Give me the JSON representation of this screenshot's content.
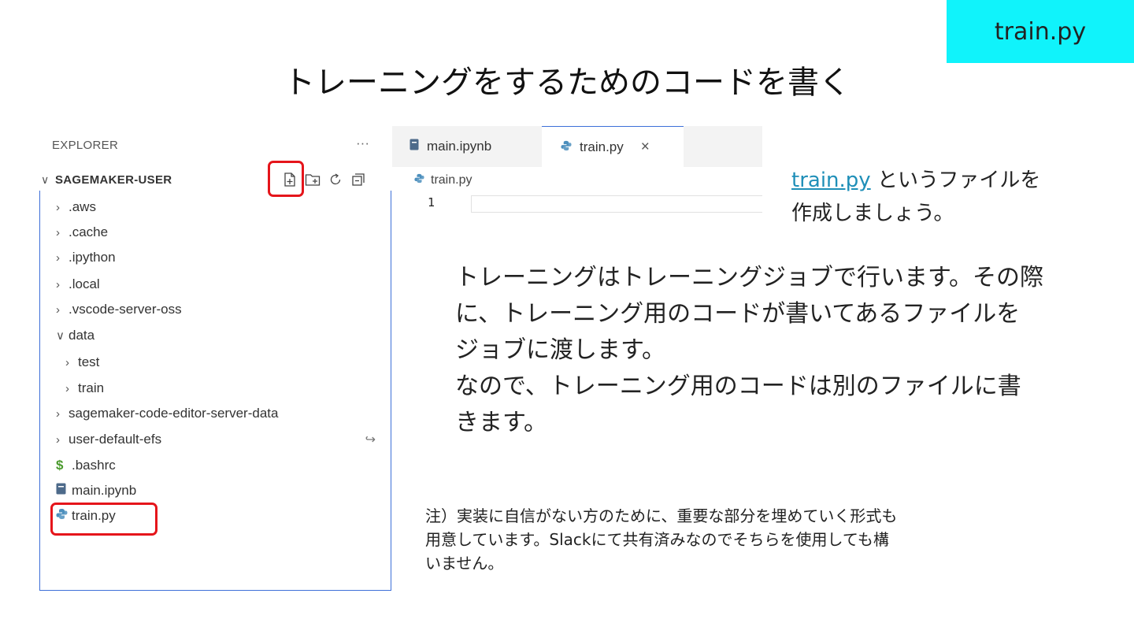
{
  "tag": "train.py",
  "title": "トレーニングをするためのコードを書く",
  "explorer": {
    "header": "EXPLORER",
    "more": "···",
    "root": "SAGEMAKER-USER",
    "items": [
      {
        "label": ".aws",
        "kind": "folder"
      },
      {
        "label": ".cache",
        "kind": "folder"
      },
      {
        "label": ".ipython",
        "kind": "folder"
      },
      {
        "label": ".local",
        "kind": "folder"
      },
      {
        "label": ".vscode-server-oss",
        "kind": "folder"
      },
      {
        "label": "data",
        "kind": "folder-open"
      },
      {
        "label": "test",
        "kind": "folder"
      },
      {
        "label": "train",
        "kind": "folder"
      },
      {
        "label": "sagemaker-code-editor-server-data",
        "kind": "folder"
      },
      {
        "label": "user-default-efs",
        "kind": "folder"
      },
      {
        "label": ".bashrc",
        "kind": "shell"
      },
      {
        "label": "main.ipynb",
        "kind": "notebook"
      },
      {
        "label": "train.py",
        "kind": "python"
      }
    ]
  },
  "editor": {
    "tabs": [
      {
        "label": "main.ipynb"
      },
      {
        "label": "train.py",
        "close": "×"
      }
    ],
    "breadcrumb": "train.py",
    "line_number": "1"
  },
  "instruction": {
    "link": "train.py",
    "line1_rest": " というファイルを",
    "line2": "作成しましょう。"
  },
  "body": [
    "トレーニングはトレーニングジョブで行います。その際",
    "に、トレーニング用のコードが書いてあるファイルを",
    "ジョブに渡します。",
    "なので、トレーニング用のコードは別のファイルに書",
    "きます。"
  ],
  "note": [
    "注）実装に自信がない方のために、重要な部分を埋めていく形式も",
    "用意しています。Slackにて共有済みなのでそちらを使用しても構",
    "いません。"
  ],
  "colors": {
    "tag_bg": "#10f3fb",
    "highlight": "#e5151b",
    "python_icon": "#4c8fbd",
    "shell_icon": "#4a9a2d",
    "notebook_icon": "#4d6a8a",
    "link": "#1f8fb8"
  }
}
